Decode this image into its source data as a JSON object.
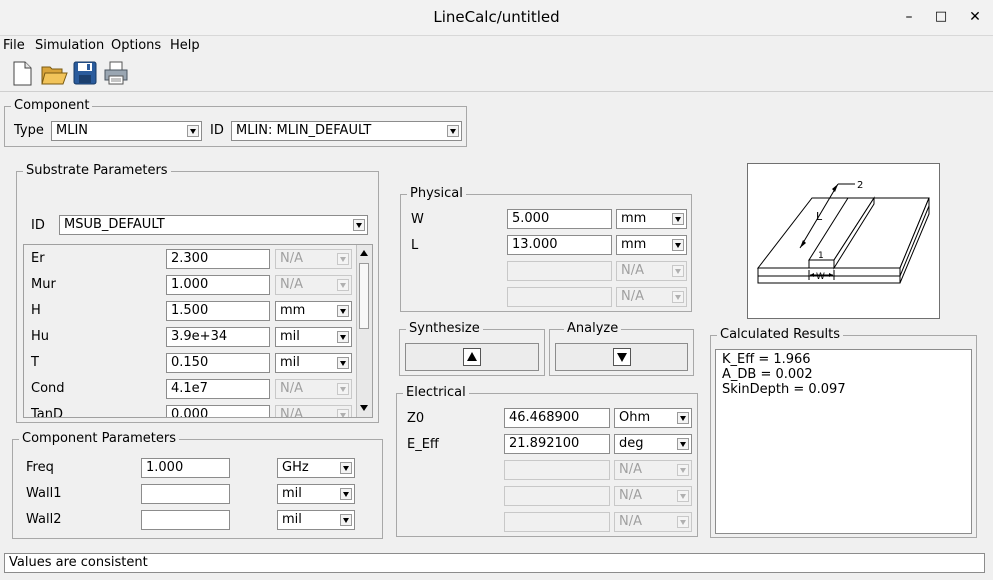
{
  "window": {
    "title": "LineCalc/untitled",
    "minimize": "–",
    "maximize": "□",
    "close": "✕"
  },
  "menu": [
    {
      "label": "File"
    },
    {
      "label": "Simulation"
    },
    {
      "label": "Options"
    },
    {
      "label": "Help"
    }
  ],
  "toolbar": {
    "icons": [
      "new-file-icon",
      "open-folder-icon",
      "save-icon",
      "print-icon"
    ]
  },
  "component": {
    "title": "Component",
    "type_label": "Type",
    "type_value": "MLIN",
    "id_label": "ID",
    "id_value": "MLIN: MLIN_DEFAULT"
  },
  "substrate": {
    "title": "Substrate Parameters",
    "id_label": "ID",
    "id_value": "MSUB_DEFAULT",
    "rows": [
      {
        "name": "Er",
        "value": "2.300",
        "unit": "N/A"
      },
      {
        "name": "Mur",
        "value": "1.000",
        "unit": "N/A"
      },
      {
        "name": "H",
        "value": "1.500",
        "unit": "mm"
      },
      {
        "name": "Hu",
        "value": "3.9e+34",
        "unit": "mil"
      },
      {
        "name": "T",
        "value": "0.150",
        "unit": "mil"
      },
      {
        "name": "Cond",
        "value": "4.1e7",
        "unit": "N/A"
      },
      {
        "name": "TanD",
        "value": "0.000",
        "unit": "N/A"
      }
    ]
  },
  "component_params": {
    "title": "Component Parameters",
    "rows": [
      {
        "name": "Freq",
        "value": "1.000",
        "unit": "GHz"
      },
      {
        "name": "Wall1",
        "value": "",
        "unit": "mil"
      },
      {
        "name": "Wall2",
        "value": "",
        "unit": "mil"
      }
    ]
  },
  "physical": {
    "title": "Physical",
    "rows": [
      {
        "name": "W",
        "value": "5.000",
        "unit": "mm"
      },
      {
        "name": "L",
        "value": "13.000",
        "unit": "mm"
      },
      {
        "name": "",
        "value": "",
        "unit": "N/A"
      },
      {
        "name": "",
        "value": "",
        "unit": "N/A"
      }
    ]
  },
  "synthesize": {
    "title": "Synthesize"
  },
  "analyze": {
    "title": "Analyze"
  },
  "electrical": {
    "title": "Electrical",
    "rows": [
      {
        "name": "Z0",
        "value": "46.468900",
        "unit": "Ohm"
      },
      {
        "name": "E_Eff",
        "value": "21.892100",
        "unit": "deg"
      },
      {
        "name": "",
        "value": "",
        "unit": "N/A"
      },
      {
        "name": "",
        "value": "",
        "unit": "N/A"
      },
      {
        "name": "",
        "value": "",
        "unit": "N/A"
      }
    ]
  },
  "diagram": {
    "label_l": "L",
    "label_w": "W",
    "label_1": "1",
    "label_2": "2"
  },
  "results": {
    "title": "Calculated Results",
    "lines": [
      "K_Eff = 1.966",
      "A_DB = 0.002",
      "SkinDepth = 0.097"
    ]
  },
  "status": {
    "text": "Values are consistent"
  }
}
